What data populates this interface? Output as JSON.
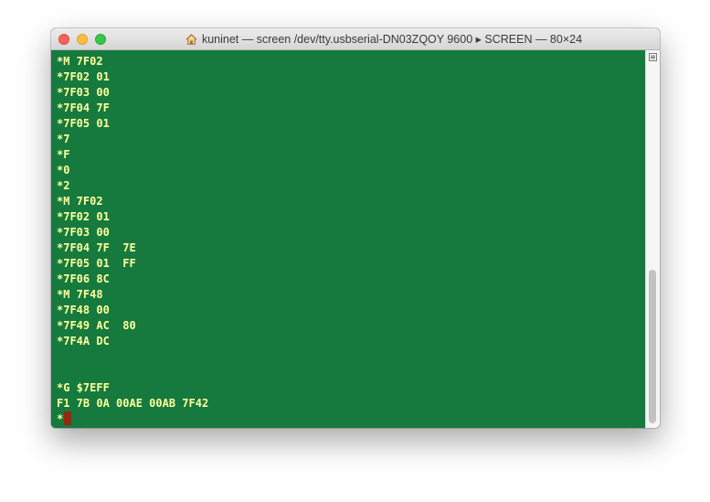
{
  "window": {
    "title": "kuninet — screen /dev/tty.usbserial-DN03ZQOY 9600 ▸ SCREEN — 80×24",
    "title_icon": "home-icon"
  },
  "terminal": {
    "lines": [
      "*M 7F02",
      "*7F02 01",
      "*7F03 00",
      "*7F04 7F",
      "*7F05 01",
      "*7",
      "*F",
      "*0",
      "*2",
      "*M 7F02",
      "*7F02 01",
      "*7F03 00",
      "*7F04 7F  7E",
      "*7F05 01  FF",
      "*7F06 8C",
      "*M 7F48",
      "*7F48 00",
      "*7F49 AC  80",
      "*7F4A DC",
      "",
      "",
      "*G $7EFF",
      "F1 7B 0A 00AE 00AB 7F42"
    ],
    "prompt": "*",
    "colors": {
      "background": "#167a3e",
      "text": "#ffff9e",
      "cursor": "#8e2b12"
    }
  }
}
